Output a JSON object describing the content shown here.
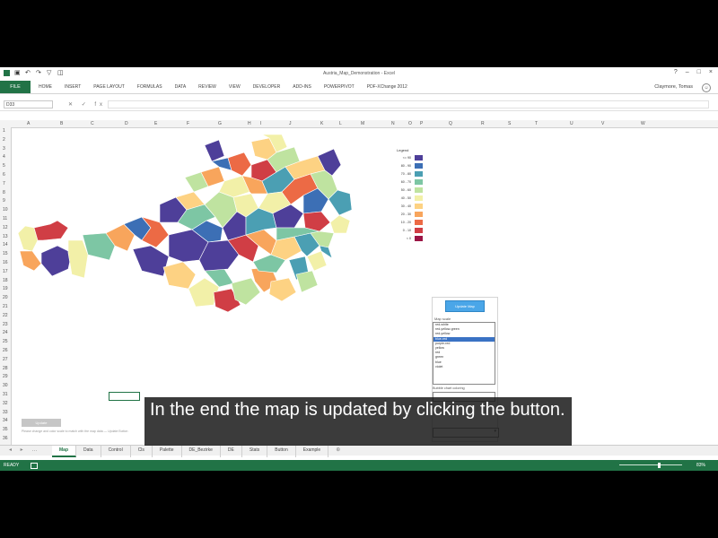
{
  "window": {
    "title": "Austria_Map_Demonstration - Excel",
    "controls": [
      "?",
      "–",
      "□",
      "×"
    ]
  },
  "ribbon": {
    "file_label": "FILE",
    "tabs": [
      "HOME",
      "INSERT",
      "PAGE LAYOUT",
      "FORMULAS",
      "DATA",
      "REVIEW",
      "VIEW",
      "DEVELOPER",
      "ADD-INS",
      "POWERPIVOT",
      "PDF-XChange 2012"
    ],
    "user": "Claymore, Tomas"
  },
  "formula_bar": {
    "name_box": "D33",
    "fx": "✕ ✓ fx"
  },
  "columns": [
    "A",
    "B",
    "C",
    "D",
    "E",
    "F",
    "G",
    "H",
    "I",
    "J",
    "K",
    "L",
    "M",
    "N",
    "O",
    "P",
    "Q",
    "R",
    "S",
    "T",
    "U",
    "V",
    "W"
  ],
  "rows": [
    "1",
    "2",
    "3",
    "4",
    "5",
    "6",
    "7",
    "8",
    "9",
    "10",
    "11",
    "12",
    "13",
    "14",
    "15",
    "16",
    "17",
    "18",
    "19",
    "20",
    "21",
    "22",
    "23",
    "24",
    "25",
    "26",
    "27",
    "28",
    "29",
    "30",
    "31",
    "32",
    "33",
    "34",
    "35",
    "36"
  ],
  "legend": {
    "title": "Legend",
    "items": [
      {
        "label": "<= 90",
        "color": "#4e3f99"
      },
      {
        "label": "80 - 90",
        "color": "#3c6fb5"
      },
      {
        "label": "70 - 80",
        "color": "#4b9fb3"
      },
      {
        "label": "60 - 70",
        "color": "#7dc6a4"
      },
      {
        "label": "50 - 60",
        "color": "#bfe3a0"
      },
      {
        "label": "40 - 50",
        "color": "#f2f0a8"
      },
      {
        "label": "30 - 40",
        "color": "#fdd283"
      },
      {
        "label": "20 - 30",
        "color": "#f8a55c"
      },
      {
        "label": "10 - 20",
        "color": "#ec6a45"
      },
      {
        "label": "0 - 10",
        "color": "#d03e45"
      },
      {
        "label": "< 0",
        "color": "#9b1545"
      }
    ]
  },
  "panel": {
    "update_button": "Update Map",
    "map_scale_label": "Map scale",
    "scale_options": [
      "red-white",
      "red-yellow-green",
      "red-yellow",
      "blue-red",
      "purple-red",
      "yellow",
      "red",
      "green",
      "blue",
      "violet"
    ],
    "selected_index": 3,
    "chart_select_label": "Bubble chart coloring"
  },
  "sheet_small_button": "Update",
  "footnote": "Please change and color scale to match with the map data — Update Button",
  "sheet_tabs": [
    "Map",
    "Data",
    "Control",
    "Cls",
    "Palette",
    "DE_Bezirke",
    "DE",
    "Stats",
    "Button",
    "Example"
  ],
  "active_sheet": "Map",
  "status": {
    "text": "READY",
    "zoom": "83%"
  },
  "caption": "In the end the map is updated by clicking the button."
}
